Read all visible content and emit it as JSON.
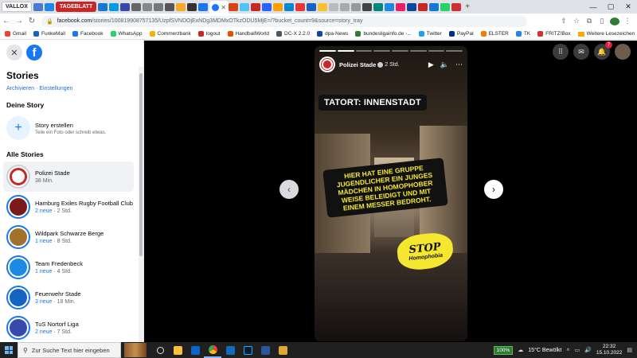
{
  "browser": {
    "tabs": {
      "labels": [
        "VALLOX",
        "TAGEBLATT"
      ],
      "active_close": "✕"
    },
    "url": {
      "host": "facebook.com",
      "path": "/stories/100819908757135/UzpfSVNDOjExNDg3MDMxOTkzODU5MjE=/?bucket_count=9&source=story_tray"
    },
    "bookmarks": [
      {
        "label": "Gmail",
        "color": "#ea4335"
      },
      {
        "label": "FunkeMail",
        "color": "#1565c0"
      },
      {
        "label": "Facebook",
        "color": "#1877f2"
      },
      {
        "label": "WhatsApp",
        "color": "#25d366"
      },
      {
        "label": "Commerzbank",
        "color": "#f9b000"
      },
      {
        "label": "logout",
        "color": "#c62828"
      },
      {
        "label": "HandballWorld",
        "color": "#e65100"
      },
      {
        "label": "DC-X 2.2.0",
        "color": "#455a64"
      },
      {
        "label": "dpa-News",
        "color": "#0d47a1"
      },
      {
        "label": "bundesligainfo.de -...",
        "color": "#2e7d32"
      },
      {
        "label": "Twitter",
        "color": "#1da1f2"
      },
      {
        "label": "PayPal",
        "color": "#003087"
      },
      {
        "label": "ELSTER",
        "color": "#f57c00"
      },
      {
        "label": "TK",
        "color": "#1e88e5"
      },
      {
        "label": "FRITZ!Box",
        "color": "#d32f2f"
      }
    ],
    "bookmarks_other": "Weitere Lesezeichen"
  },
  "sidebar": {
    "title": "Stories",
    "links": {
      "archive": "Archivieren",
      "sep": "·",
      "settings": "Einstellungen"
    },
    "your_story_heading": "Deine Story",
    "create": {
      "title": "Story erstellen",
      "subtitle": "Teile ein Foto oder schreib etwas."
    },
    "all_stories_heading": "Alle Stories",
    "stories": [
      {
        "name": "Polizei Stade",
        "new": "",
        "time": "38 Min.",
        "color": "#c62828",
        "active": true,
        "seen": true
      },
      {
        "name": "Hamburg Exiles Rugby Football Club",
        "new": "2 neue",
        "time": "2 Std.",
        "color": "#7b1a1a",
        "active": false,
        "seen": false
      },
      {
        "name": "Wildpark Schwarze Berge",
        "new": "1 neue",
        "time": "8 Std.",
        "color": "#a0722b",
        "active": false,
        "seen": false
      },
      {
        "name": "Team Fredenbeck",
        "new": "1 neue",
        "time": "4 Std.",
        "color": "#1e88e5",
        "active": false,
        "seen": false
      },
      {
        "name": "Feuerwehr Stade",
        "new": "3 neue",
        "time": "18 Min.",
        "color": "#1565c0",
        "active": false,
        "seen": false
      },
      {
        "name": "TuS Nortorf Liga",
        "new": "2 neue",
        "time": "7 Std.",
        "color": "#3949ab",
        "active": false,
        "seen": false
      }
    ]
  },
  "viewer": {
    "notifications_count": "7",
    "story": {
      "author": "Polizei Stade",
      "time": "2 Std.",
      "progress_segments": 8,
      "progress_done": 2,
      "caption_top": "TATORT: INNENSTADT",
      "message": "HIER HAT EINE GRUPPE JUGENDLICHER EIN JUNGES MÄDCHEN IN HOMOPHOBER WEISE BELEIDIGT UND MIT EINEM MESSER BEDROHT.",
      "sticker_line1": "STOP",
      "sticker_line2": "Homophobia"
    }
  },
  "taskbar": {
    "search_placeholder": "Zur Suche Text hier eingeben",
    "battery": "100%",
    "weather": "15°C  Bewölkt",
    "time": "22:32",
    "date": "15.10.2022"
  }
}
